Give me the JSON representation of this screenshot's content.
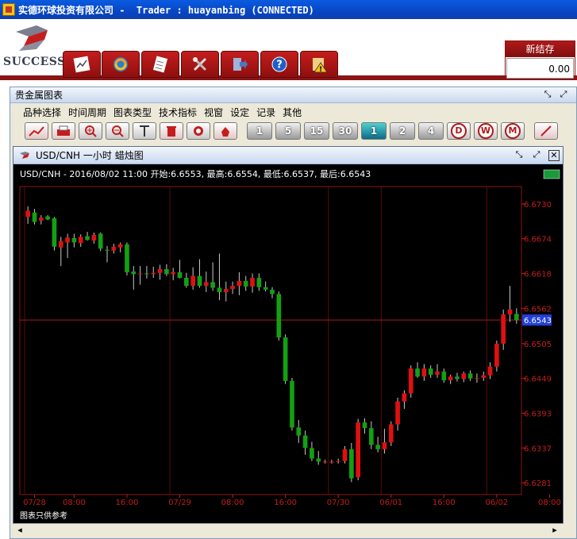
{
  "window": {
    "title": "实德环球投资有限公司 -  Trader : huayanbing (CONNECTED)"
  },
  "brand": {
    "logo_text": "SUCCESS"
  },
  "main_toolbar": {
    "buttons": [
      {
        "id": "chart",
        "icon": "chart-icon"
      },
      {
        "id": "refresh",
        "icon": "refresh-icon"
      },
      {
        "id": "orders",
        "icon": "document-icon"
      },
      {
        "id": "tools",
        "icon": "tools-icon"
      },
      {
        "id": "logout",
        "icon": "exit-icon"
      },
      {
        "id": "help",
        "icon": "help-icon"
      },
      {
        "id": "alert",
        "icon": "warning-icon"
      }
    ]
  },
  "balance": {
    "label": "新结存",
    "value": "0.00"
  },
  "panel": {
    "title": "贵金属图表",
    "menus": [
      "品种选择",
      "时间周期",
      "图表类型",
      "技术指标",
      "视窗",
      "设定",
      "记录",
      "其他"
    ],
    "periods": [
      "1",
      "5",
      "15",
      "30",
      "1",
      "2",
      "4"
    ],
    "timeframes": [
      "D",
      "W",
      "M"
    ]
  },
  "chart_window": {
    "title": "USD/CNH 一小时 蜡烛图",
    "info_line": "USD/CNH - 2016/08/02 11:00 开始:6.6553, 最高:6.6554, 最低:6.6537, 最后:6.6543",
    "footnote": "图表只供参考"
  },
  "chart_data": {
    "type": "candlestick",
    "symbol": "USD/CNH",
    "current_price": 6.6543,
    "current_price_label": "6.6543",
    "y_ticks": [
      6.6281,
      6.6337,
      6.6393,
      6.6449,
      6.6505,
      6.6562,
      6.6618,
      6.6674,
      6.673
    ],
    "y_tick_labels": [
      "6.6281",
      "6.6337",
      "6.6393",
      "6.6449",
      "6.6505",
      "6.6562",
      "6.6618",
      "6.6674",
      "6.6730"
    ],
    "ylim": [
      6.6262,
      6.6758
    ],
    "x_tick_labels": [
      {
        "label": "07/28",
        "i": 1
      },
      {
        "label": "08:00",
        "i": 7
      },
      {
        "label": "16:00",
        "i": 15
      },
      {
        "label": "07/29",
        "i": 23
      },
      {
        "label": "08:00",
        "i": 31
      },
      {
        "label": "16:00",
        "i": 39
      },
      {
        "label": "07/30",
        "i": 47
      },
      {
        "label": "06/01",
        "i": 55
      },
      {
        "label": "16:00",
        "i": 63
      },
      {
        "label": "06/02",
        "i": 71
      },
      {
        "label": "08:00",
        "i": 79
      }
    ],
    "day_dividers": [
      0,
      22,
      46,
      54,
      70
    ],
    "candles": [
      {
        "o": 6.6709,
        "h": 6.6726,
        "l": 6.6698,
        "c": 6.6719
      },
      {
        "o": 6.6716,
        "h": 6.6722,
        "l": 6.6697,
        "c": 6.6701
      },
      {
        "o": 6.6703,
        "h": 6.6712,
        "l": 6.6697,
        "c": 6.6708
      },
      {
        "o": 6.671,
        "h": 6.6712,
        "l": 6.6704,
        "c": 6.6705
      },
      {
        "o": 6.6707,
        "h": 6.6709,
        "l": 6.6655,
        "c": 6.6661
      },
      {
        "o": 6.666,
        "h": 6.6677,
        "l": 6.663,
        "c": 6.667
      },
      {
        "o": 6.6668,
        "h": 6.6682,
        "l": 6.6643,
        "c": 6.6676
      },
      {
        "o": 6.6675,
        "h": 6.6682,
        "l": 6.666,
        "c": 6.6668
      },
      {
        "o": 6.6667,
        "h": 6.6681,
        "l": 6.6661,
        "c": 6.6677
      },
      {
        "o": 6.6678,
        "h": 6.6685,
        "l": 6.6671,
        "c": 6.6672
      },
      {
        "o": 6.6671,
        "h": 6.6684,
        "l": 6.6666,
        "c": 6.668
      },
      {
        "o": 6.6682,
        "h": 6.6684,
        "l": 6.6654,
        "c": 6.6658
      },
      {
        "o": 6.6656,
        "h": 6.6662,
        "l": 6.6636,
        "c": 6.6655
      },
      {
        "o": 6.6655,
        "h": 6.6666,
        "l": 6.665,
        "c": 6.6661
      },
      {
        "o": 6.666,
        "h": 6.6668,
        "l": 6.6652,
        "c": 6.6665
      },
      {
        "o": 6.6665,
        "h": 6.6668,
        "l": 6.6615,
        "c": 6.662
      },
      {
        "o": 6.6621,
        "h": 6.663,
        "l": 6.6592,
        "c": 6.6617
      },
      {
        "o": 6.6617,
        "h": 6.663,
        "l": 6.66,
        "c": 6.6618
      },
      {
        "o": 6.6618,
        "h": 6.663,
        "l": 6.661,
        "c": 6.6617
      },
      {
        "o": 6.6617,
        "h": 6.6629,
        "l": 6.6611,
        "c": 6.6619
      },
      {
        "o": 6.6619,
        "h": 6.6632,
        "l": 6.6608,
        "c": 6.6625
      },
      {
        "o": 6.6625,
        "h": 6.6633,
        "l": 6.6614,
        "c": 6.6617
      },
      {
        "o": 6.6617,
        "h": 6.6627,
        "l": 6.6607,
        "c": 6.662
      },
      {
        "o": 6.662,
        "h": 6.664,
        "l": 6.661,
        "c": 6.6611
      },
      {
        "o": 6.6611,
        "h": 6.6619,
        "l": 6.6595,
        "c": 6.6598
      },
      {
        "o": 6.6598,
        "h": 6.6628,
        "l": 6.6592,
        "c": 6.6614
      },
      {
        "o": 6.6614,
        "h": 6.6641,
        "l": 6.6595,
        "c": 6.6598
      },
      {
        "o": 6.6598,
        "h": 6.6621,
        "l": 6.6588,
        "c": 6.6604
      },
      {
        "o": 6.6604,
        "h": 6.6636,
        "l": 6.659,
        "c": 6.6595
      },
      {
        "o": 6.6595,
        "h": 6.665,
        "l": 6.6575,
        "c": 6.6588
      },
      {
        "o": 6.6588,
        "h": 6.6605,
        "l": 6.6573,
        "c": 6.6593
      },
      {
        "o": 6.6593,
        "h": 6.6605,
        "l": 6.6585,
        "c": 6.6598
      },
      {
        "o": 6.6598,
        "h": 6.662,
        "l": 6.6583,
        "c": 6.6606
      },
      {
        "o": 6.6606,
        "h": 6.6614,
        "l": 6.659,
        "c": 6.6597
      },
      {
        "o": 6.6597,
        "h": 6.6618,
        "l": 6.6587,
        "c": 6.6611
      },
      {
        "o": 6.6611,
        "h": 6.6618,
        "l": 6.659,
        "c": 6.6596
      },
      {
        "o": 6.6596,
        "h": 6.6605,
        "l": 6.6589,
        "c": 6.6592
      },
      {
        "o": 6.6592,
        "h": 6.6596,
        "l": 6.6578,
        "c": 6.6585
      },
      {
        "o": 6.6585,
        "h": 6.6589,
        "l": 6.651,
        "c": 6.6515
      },
      {
        "o": 6.6515,
        "h": 6.652,
        "l": 6.644,
        "c": 6.6445
      },
      {
        "o": 6.6445,
        "h": 6.645,
        "l": 6.6365,
        "c": 6.637
      },
      {
        "o": 6.637,
        "h": 6.6382,
        "l": 6.6345,
        "c": 6.6357
      },
      {
        "o": 6.6357,
        "h": 6.6365,
        "l": 6.6326,
        "c": 6.6337
      },
      {
        "o": 6.6337,
        "h": 6.6347,
        "l": 6.6316,
        "c": 6.632
      },
      {
        "o": 6.632,
        "h": 6.6332,
        "l": 6.631,
        "c": 6.6315
      },
      {
        "o": 6.6315,
        "h": 6.6318,
        "l": 6.6312,
        "c": 6.6315
      },
      {
        "o": 6.6315,
        "h": 6.6318,
        "l": 6.6312,
        "c": 6.6315
      },
      {
        "o": 6.6315,
        "h": 6.632,
        "l": 6.6312,
        "c": 6.6316
      },
      {
        "o": 6.6316,
        "h": 6.634,
        "l": 6.6312,
        "c": 6.6335
      },
      {
        "o": 6.6335,
        "h": 6.6345,
        "l": 6.6282,
        "c": 6.6288
      },
      {
        "o": 6.629,
        "h": 6.6384,
        "l": 6.6285,
        "c": 6.6378
      },
      {
        "o": 6.6378,
        "h": 6.6385,
        "l": 6.636,
        "c": 6.6369
      },
      {
        "o": 6.6369,
        "h": 6.638,
        "l": 6.6335,
        "c": 6.6342
      },
      {
        "o": 6.6342,
        "h": 6.6355,
        "l": 6.633,
        "c": 6.6335
      },
      {
        "o": 6.6335,
        "h": 6.6368,
        "l": 6.6328,
        "c": 6.6346
      },
      {
        "o": 6.6346,
        "h": 6.638,
        "l": 6.634,
        "c": 6.6375
      },
      {
        "o": 6.6375,
        "h": 6.6418,
        "l": 6.6365,
        "c": 6.6412
      },
      {
        "o": 6.6412,
        "h": 6.643,
        "l": 6.64,
        "c": 6.6425
      },
      {
        "o": 6.6425,
        "h": 6.647,
        "l": 6.6418,
        "c": 6.6465
      },
      {
        "o": 6.6465,
        "h": 6.6475,
        "l": 6.645,
        "c": 6.6452
      },
      {
        "o": 6.6452,
        "h": 6.6472,
        "l": 6.6445,
        "c": 6.6465
      },
      {
        "o": 6.6465,
        "h": 6.647,
        "l": 6.645,
        "c": 6.6455
      },
      {
        "o": 6.6455,
        "h": 6.6472,
        "l": 6.645,
        "c": 6.646
      },
      {
        "o": 6.646,
        "h": 6.6465,
        "l": 6.6442,
        "c": 6.6446
      },
      {
        "o": 6.6446,
        "h": 6.6455,
        "l": 6.644,
        "c": 6.6452
      },
      {
        "o": 6.6452,
        "h": 6.6458,
        "l": 6.6444,
        "c": 6.6448
      },
      {
        "o": 6.6448,
        "h": 6.646,
        "l": 6.6443,
        "c": 6.6457
      },
      {
        "o": 6.6457,
        "h": 6.6462,
        "l": 6.6445,
        "c": 6.6449
      },
      {
        "o": 6.6449,
        "h": 6.6457,
        "l": 6.6442,
        "c": 6.645
      },
      {
        "o": 6.645,
        "h": 6.646,
        "l": 6.6445,
        "c": 6.6454
      },
      {
        "o": 6.6454,
        "h": 6.6475,
        "l": 6.6448,
        "c": 6.6468
      },
      {
        "o": 6.6468,
        "h": 6.651,
        "l": 6.646,
        "c": 6.6505
      },
      {
        "o": 6.6505,
        "h": 6.656,
        "l": 6.6495,
        "c": 6.6552
      },
      {
        "o": 6.6552,
        "h": 6.6598,
        "l": 6.654,
        "c": 6.656
      },
      {
        "o": 6.6553,
        "h": 6.6562,
        "l": 6.6537,
        "c": 6.6543
      }
    ]
  }
}
